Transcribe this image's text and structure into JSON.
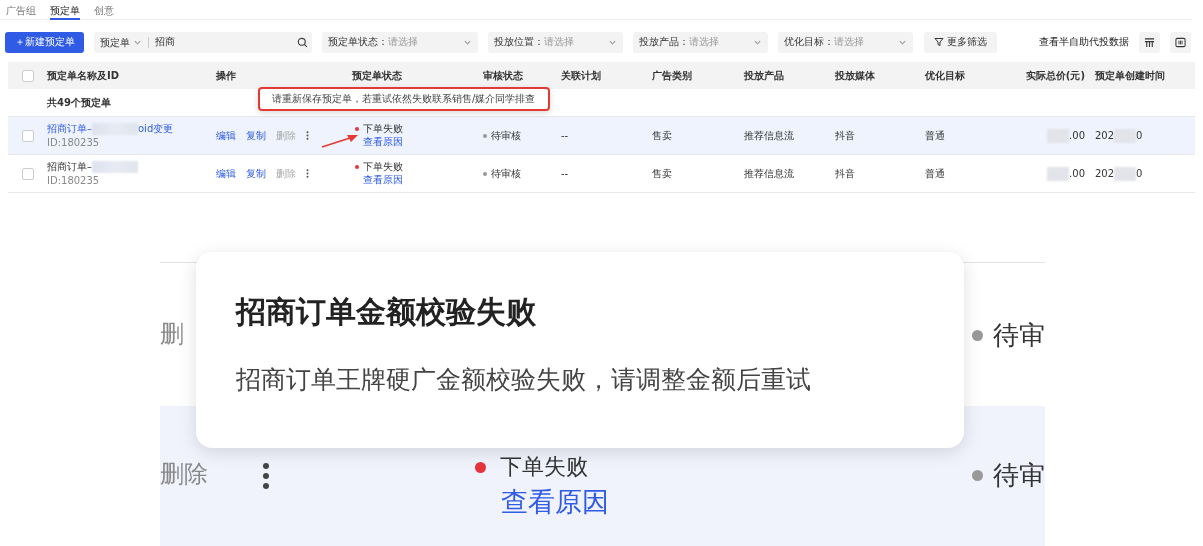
{
  "tabs": [
    {
      "label": "广告组",
      "selected": false
    },
    {
      "label": "预定单",
      "selected": true
    },
    {
      "label": "创意",
      "selected": false
    }
  ],
  "toolbar": {
    "create_button": "＋新建预定单",
    "search": {
      "scope": "预定单",
      "value": "招商"
    },
    "filters": [
      {
        "label": "预定单状态：",
        "placeholder": "请选择"
      },
      {
        "label": "投放位置：",
        "placeholder": "请选择"
      },
      {
        "label": "投放产品：",
        "placeholder": "请选择"
      },
      {
        "label": "优化目标：",
        "placeholder": "请选择"
      }
    ],
    "more_filters": "更多筛选",
    "link": "查看半自助代投数据"
  },
  "table": {
    "all_checked": false,
    "columns": [
      "预定单名称及ID",
      "操作",
      "预定单状态",
      "审核状态",
      "关联计划",
      "广告类别",
      "投放产品",
      "投放媒体",
      "优化目标",
      "实际总价(元)",
      "预定单创建时间"
    ],
    "summary": "共49个预定单",
    "rows": [
      {
        "selected": true,
        "checked": false,
        "name": "招商订单–",
        "name_suffix": "oid变更",
        "id": "ID:180235",
        "actions": [
          {
            "label": "编辑",
            "disabled": false
          },
          {
            "label": "复制",
            "disabled": false
          },
          {
            "label": "删除",
            "disabled": true
          }
        ],
        "status": "下单失败",
        "reason_link": "查看原因",
        "review": "待审核",
        "plan": "--",
        "category": "售卖",
        "product": "推荐信息流",
        "media": "抖音",
        "goal": "普通",
        "price": ".00",
        "created": "202",
        "created_suffix": "0"
      },
      {
        "selected": false,
        "checked": false,
        "name": "招商订单–",
        "name_suffix": "",
        "id": "ID:180235",
        "actions": [
          {
            "label": "编辑",
            "disabled": false
          },
          {
            "label": "复制",
            "disabled": false
          },
          {
            "label": "删除",
            "disabled": true
          }
        ],
        "status": "下单失败",
        "reason_link": "查看原因",
        "review": "待审核",
        "plan": "--",
        "category": "售卖",
        "product": "推荐信息流",
        "media": "抖音",
        "goal": "普通",
        "price": ".00",
        "created": "202",
        "created_suffix": "0"
      }
    ]
  },
  "annotation": {
    "text": "请重新保存预定单，若重试依然失败联系销售/媒介同学排查"
  },
  "inset": {
    "rows": [
      {
        "action": "删",
        "review": "待审"
      },
      {
        "action": "删除",
        "status": "下单失败",
        "reason_link": "查看原因",
        "review": "待审"
      }
    ],
    "popover": {
      "title": "招商订单金额校验失败",
      "message": "招商订单王牌硬广金额校验失败，请调整金额后重试"
    }
  }
}
